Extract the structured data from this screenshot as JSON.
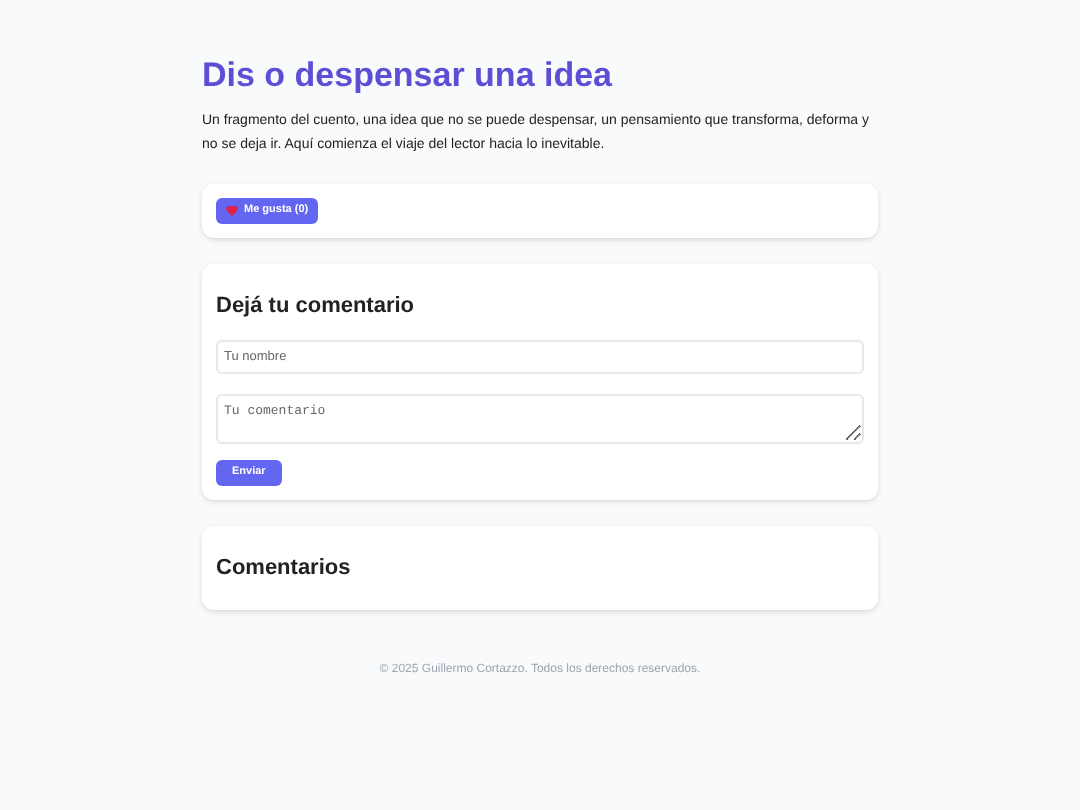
{
  "article": {
    "title": "Dis o despensar una idea",
    "body": "Un fragmento del cuento, una idea que no se puede despensar, un pensamiento que transforma, deforma y no se deja ir. Aquí comienza el viaje del lector hacia lo inevitable."
  },
  "like_button": {
    "label": "Me gusta (0)"
  },
  "comment_form": {
    "title": "Dejá tu comentario",
    "name_field": {
      "placeholder": "Tu nombre"
    },
    "comment_field": {
      "placeholder": "Tu comentario"
    },
    "submit": "Enviar"
  },
  "comments": {
    "title": "Comentarios"
  },
  "footer": "© 2025 Guillermo Cortazzo. Todos los derechos reservados."
}
